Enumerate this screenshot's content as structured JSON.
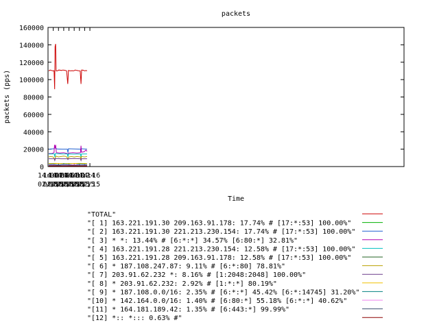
{
  "chart_data": {
    "type": "line",
    "title": "packets",
    "xlabel": "Time",
    "ylabel": "packets (pps)",
    "x_date": "02/15",
    "xlim_min": [
      840,
      976
    ],
    "ylim": [
      0,
      160000
    ],
    "yticks": [
      0,
      20000,
      40000,
      60000,
      80000,
      100000,
      120000,
      140000,
      160000
    ],
    "xticks": [
      {
        "min": 840,
        "time": "14:00",
        "date": "02/15"
      },
      {
        "min": 842,
        "time": "14:02",
        "date": "02/15"
      },
      {
        "min": 844,
        "time": "14:04",
        "date": "02/15"
      },
      {
        "min": 846,
        "time": "14:06",
        "date": "02/15"
      },
      {
        "min": 848,
        "time": "14:08",
        "date": "02/15"
      },
      {
        "min": 850,
        "time": "14:10",
        "date": "02/15"
      },
      {
        "min": 852,
        "time": "14:12",
        "date": "02/15"
      },
      {
        "min": 854,
        "time": "14:14",
        "date": "02/15"
      },
      {
        "min": 856,
        "time": "14:16",
        "date": "02/15"
      }
    ],
    "grid": false,
    "legend_position": "bottom",
    "series": [
      {
        "name": "\"TOTAL\"",
        "color": "#cc0000",
        "points": [
          [
            840.25,
            110000
          ],
          [
            840.8,
            111000
          ],
          [
            841.3,
            110500
          ],
          [
            841.8,
            110000
          ],
          [
            842.3,
            110200
          ],
          [
            842.55,
            89000
          ],
          [
            842.7,
            138000
          ],
          [
            842.9,
            141000
          ],
          [
            843.1,
            110000
          ],
          [
            843.6,
            110000
          ],
          [
            844.1,
            111000
          ],
          [
            844.6,
            110800
          ],
          [
            845.1,
            110500
          ],
          [
            845.6,
            111000
          ],
          [
            846.1,
            110800
          ],
          [
            846.6,
            110600
          ],
          [
            847.1,
            110000
          ],
          [
            847.55,
            95000
          ],
          [
            847.8,
            110500
          ],
          [
            848.5,
            110000
          ],
          [
            849.2,
            110300
          ],
          [
            849.8,
            110000
          ],
          [
            850.4,
            111000
          ],
          [
            851.0,
            110500
          ],
          [
            851.7,
            110200
          ],
          [
            852.3,
            110000
          ],
          [
            852.6,
            95000
          ],
          [
            852.85,
            111000
          ],
          [
            853.4,
            110800
          ],
          [
            854.0,
            110000
          ],
          [
            854.5,
            110400
          ],
          [
            854.9,
            110200
          ]
        ]
      },
      {
        "name": "\"[ 1] 163.221.191.30 209.163.91.178: 17.74% # [17:*:53] 100.00%\"",
        "color": "#00b000",
        "points": [
          [
            840.25,
            1500
          ],
          [
            842.6,
            1000
          ],
          [
            847.6,
            900
          ],
          [
            852.6,
            900
          ],
          [
            854.9,
            1500
          ]
        ]
      },
      {
        "name": "\"[ 2] 163.221.191.30 221.213.230.154: 17.74% # [17:*:53] 100.00%\"",
        "color": "#1f5fd0",
        "points": [
          [
            840.25,
            20000
          ],
          [
            842.3,
            20500
          ],
          [
            842.6,
            23000
          ],
          [
            842.9,
            21000
          ],
          [
            843.5,
            20200
          ],
          [
            845.5,
            20000
          ],
          [
            847.4,
            20000
          ],
          [
            847.6,
            16000
          ],
          [
            847.8,
            20500
          ],
          [
            850.5,
            20200
          ],
          [
            852.4,
            20000
          ],
          [
            852.6,
            18000
          ],
          [
            852.8,
            20500
          ],
          [
            854.9,
            20000
          ]
        ]
      },
      {
        "name": "\"[ 3] * *: 13.44% # [6:*:*] 34.57% [6:80:*] 32.81%\"",
        "color": "#b000b0",
        "points": [
          [
            840.25,
            15000
          ],
          [
            841.5,
            15000
          ],
          [
            842.3,
            16000
          ],
          [
            842.5,
            25000
          ],
          [
            842.7,
            21000
          ],
          [
            842.9,
            25000
          ],
          [
            843.2,
            16000
          ],
          [
            844.5,
            15500
          ],
          [
            846,
            16000
          ],
          [
            847.4,
            15000
          ],
          [
            847.6,
            12000
          ],
          [
            847.8,
            15500
          ],
          [
            849.5,
            16000
          ],
          [
            851,
            15500
          ],
          [
            852.4,
            16000
          ],
          [
            852.6,
            24000
          ],
          [
            852.8,
            16500
          ],
          [
            853.8,
            17000
          ],
          [
            854.5,
            19000
          ],
          [
            854.9,
            17500
          ]
        ]
      },
      {
        "name": "\"[ 4] 163.221.191.28 221.213.230.154: 12.58% # [17:*:53] 100.00%\"",
        "color": "#00c0c0",
        "points": [
          [
            840.25,
            14500
          ],
          [
            842.4,
            14500
          ],
          [
            842.6,
            11000
          ],
          [
            842.8,
            15000
          ],
          [
            845,
            14500
          ],
          [
            847.4,
            14500
          ],
          [
            847.6,
            11000
          ],
          [
            847.8,
            14500
          ],
          [
            850,
            14300
          ],
          [
            852.4,
            14500
          ],
          [
            852.6,
            11000
          ],
          [
            852.8,
            14500
          ],
          [
            854.9,
            14500
          ]
        ]
      },
      {
        "name": "\"[ 5] 163.221.191.28 209.163.91.178: 12.58% # [17:*:53] 100.00%\"",
        "color": "#206020",
        "points": [
          [
            840.25,
            1000
          ],
          [
            845,
            1100
          ],
          [
            850,
            1000
          ],
          [
            854.9,
            1000
          ]
        ]
      },
      {
        "name": "\"[ 6] * 187.108.247.87: 9.11% # [6:*:80] 78.81%\"",
        "color": "#b8a000",
        "points": [
          [
            840.25,
            11000
          ],
          [
            841,
            11500
          ],
          [
            842,
            11000
          ],
          [
            842.6,
            8000
          ],
          [
            843,
            12000
          ],
          [
            844,
            11000
          ],
          [
            845,
            11500
          ],
          [
            846,
            12000
          ],
          [
            847,
            11500
          ],
          [
            847.6,
            9000
          ],
          [
            848,
            11000
          ],
          [
            849,
            11500
          ],
          [
            850,
            11000
          ],
          [
            851,
            11500
          ],
          [
            852.4,
            11000
          ],
          [
            852.6,
            8000
          ],
          [
            852.8,
            11500
          ],
          [
            854,
            11000
          ],
          [
            854.9,
            11500
          ]
        ]
      },
      {
        "name": "\"[ 7] 203.91.62.232 *: 8.16% # [1:2048:2048] 100.00%\"",
        "color": "#6a3a8a",
        "points": [
          [
            840.25,
            9000
          ],
          [
            842.4,
            9000
          ],
          [
            842.6,
            7000
          ],
          [
            842.8,
            9200
          ],
          [
            845,
            9000
          ],
          [
            847.4,
            9000
          ],
          [
            847.6,
            8000
          ],
          [
            847.8,
            9000
          ],
          [
            850,
            9200
          ],
          [
            852.4,
            9000
          ],
          [
            852.6,
            7000
          ],
          [
            852.8,
            9000
          ],
          [
            854.9,
            9000
          ]
        ]
      },
      {
        "name": "\"[ 8] * 203.91.62.232: 2.92% # [1:*:*] 80.19%\"",
        "color": "#f0c000",
        "points": [
          [
            840.25,
            3500
          ],
          [
            843,
            3600
          ],
          [
            846,
            3400
          ],
          [
            849,
            3500
          ],
          [
            852,
            3600
          ],
          [
            854.9,
            3500
          ]
        ]
      },
      {
        "name": "\"[ 9] * 187.108.0.0/16: 2.35% # [6:*:*] 45.42% [6:*:14745] 31.20%\"",
        "color": "#008080",
        "points": [
          [
            840.25,
            2500
          ],
          [
            842,
            3000
          ],
          [
            844,
            2000
          ],
          [
            846,
            3000
          ],
          [
            848,
            2500
          ],
          [
            850,
            2000
          ],
          [
            852,
            3000
          ],
          [
            854.9,
            2500
          ]
        ]
      },
      {
        "name": "\"[10] * 142.164.0.0/16: 1.40% # [6:80:*] 55.18% [6:*:*] 40.62%\"",
        "color": "#ee82ee",
        "points": [
          [
            840.25,
            1800
          ],
          [
            842,
            2200
          ],
          [
            844,
            1500
          ],
          [
            846,
            2000
          ],
          [
            848,
            1800
          ],
          [
            850,
            2100
          ],
          [
            852,
            1600
          ],
          [
            854.9,
            1900
          ]
        ]
      },
      {
        "name": "\"[11] * 164.181.189.42: 1.35% # [6:443:*] 99.99%\"",
        "color": "#3a5070",
        "points": [
          [
            840.25,
            1200
          ],
          [
            843,
            1300
          ],
          [
            846,
            1100
          ],
          [
            849,
            1300
          ],
          [
            852,
            1200
          ],
          [
            854.9,
            1200
          ]
        ]
      },
      {
        "name": "\"[12] *:: *::: 0.63% #\"",
        "color": "#8b0000",
        "points": [
          [
            840.25,
            600
          ],
          [
            843,
            700
          ],
          [
            846,
            500
          ],
          [
            849,
            700
          ],
          [
            852,
            600
          ],
          [
            854.9,
            600
          ]
        ]
      }
    ]
  }
}
